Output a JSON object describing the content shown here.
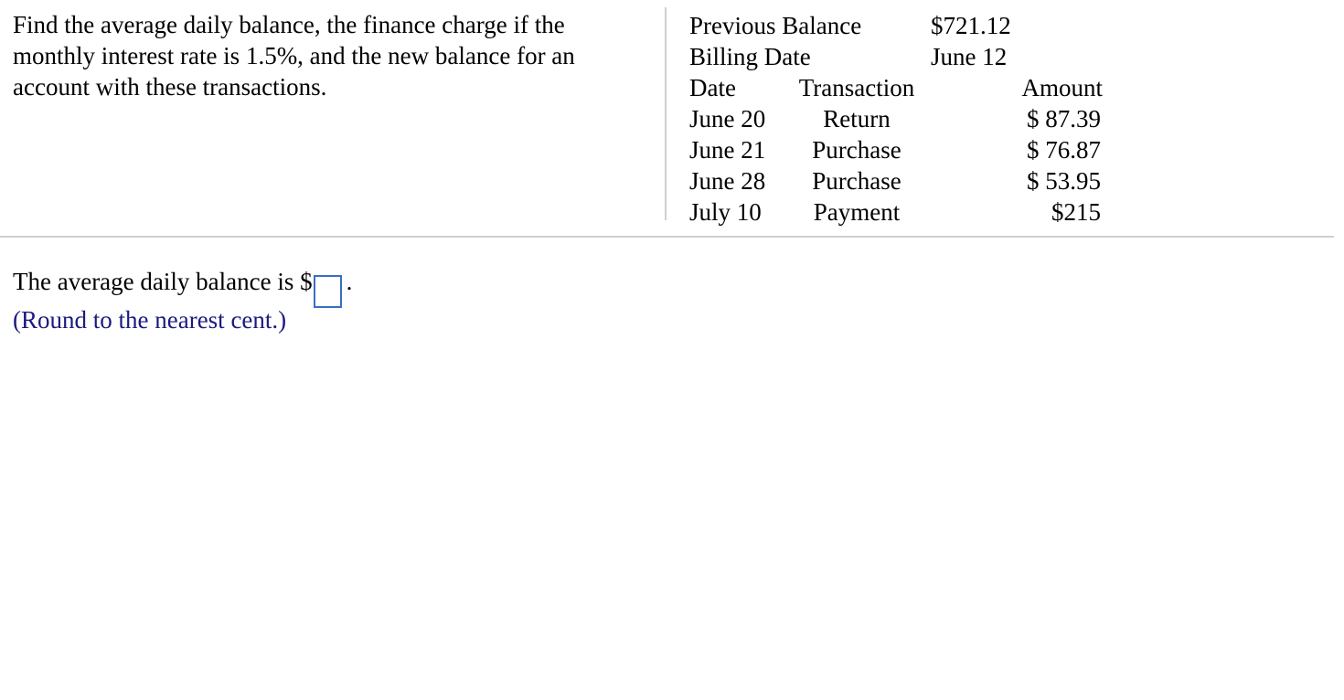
{
  "question": {
    "text": "Find the average daily balance, the finance charge if the monthly interest rate is 1.5%, and the new balance for an account with these transactions."
  },
  "account": {
    "previous_balance_label": "Previous Balance",
    "previous_balance_value": "$721.12",
    "billing_date_label": "Billing Date",
    "billing_date_value": "June 12",
    "headers": {
      "date": "Date",
      "transaction": "Transaction",
      "amount": "Amount"
    },
    "transactions": [
      {
        "date": "June 20",
        "transaction": "Return",
        "amount": "$ 87.39"
      },
      {
        "date": "June 21",
        "transaction": "Purchase",
        "amount": "$ 76.87"
      },
      {
        "date": "June 28",
        "transaction": "Purchase",
        "amount": "$ 53.95"
      },
      {
        "date": "July 10",
        "transaction": "Payment",
        "amount": "$215"
      }
    ]
  },
  "answer": {
    "prefix": "The average daily balance is $",
    "suffix": ".",
    "value": "",
    "hint": "(Round to the nearest cent.)"
  },
  "colors": {
    "answer_box_border": "#3a6fc4",
    "hint_text": "#1a1a80",
    "divider": "#d0d0d0"
  }
}
